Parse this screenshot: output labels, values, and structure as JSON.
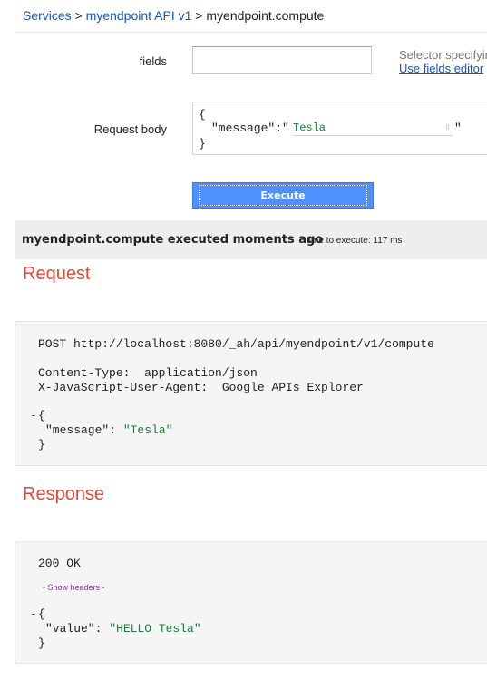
{
  "breadcrumb": {
    "services": "Services",
    "sep1": ">",
    "api": "myendpoint API v1",
    "sep2": ">",
    "method": "myendpoint.compute"
  },
  "form": {
    "fields_label": "fields",
    "fields_value": "",
    "fields_hint": "Selector specifying",
    "fields_editor_link": "Use fields editor",
    "request_body_label": "Request body",
    "body": {
      "open": "{",
      "key": "\"message\":",
      "quote_open": "\"",
      "value": "Tesla",
      "quote_close": "\"",
      "close": "}"
    },
    "execute_label": "Execute"
  },
  "result": {
    "executed_text": "myendpoint.compute executed moments ago",
    "time_text": "time to execute: 117 ms"
  },
  "request": {
    "title": "Request",
    "line1": "POST http://localhost:8080/_ah/api/myendpoint/v1/compute",
    "line2": "Content-Type:  application/json",
    "line3": "X-JavaScript-User-Agent:  Google APIs Explorer",
    "toggle": "-",
    "open": "{",
    "key": "\"message\": ",
    "value": "\"Tesla\"",
    "close": "}"
  },
  "response": {
    "title": "Response",
    "status": "200 OK",
    "show_headers": "- Show headers -",
    "toggle": "-",
    "open": "{",
    "key": "\"value\": ",
    "value": "\"HELLO Tesla\"",
    "close": "}"
  }
}
